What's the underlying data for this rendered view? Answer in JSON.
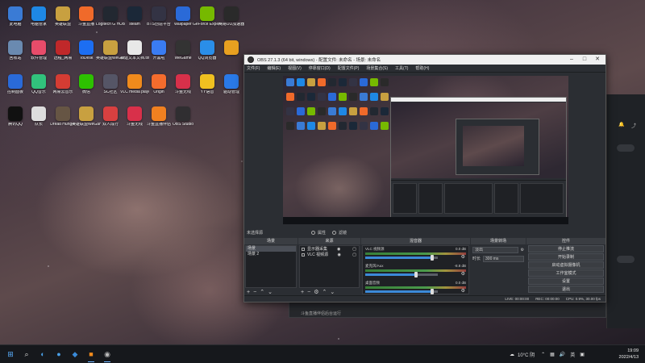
{
  "desktop": {
    "icons": [
      {
        "label": "此电脑",
        "icon": "computer-icon",
        "color": "#3a7bd5"
      },
      {
        "label": "电脑管家",
        "icon": "shield-icon",
        "color": "#1e88e5"
      },
      {
        "label": "英雄联盟",
        "icon": "game-icon",
        "color": "#c8a040"
      },
      {
        "label": "斗鱼直播",
        "icon": "fish-icon",
        "color": "#f06a2a"
      },
      {
        "label": "Logitech G HUB",
        "icon": "g-hub-icon",
        "color": "#222831"
      },
      {
        "label": "steam",
        "icon": "steam-icon",
        "color": "#1b2838"
      },
      {
        "label": "BTS创造平台",
        "icon": "grid-icon",
        "color": "#334"
      },
      {
        "label": "wallpaper",
        "icon": "wallpaper-icon",
        "color": "#2a6ad8"
      },
      {
        "label": "GeForce Experience",
        "icon": "nvidia-icon",
        "color": "#76b900"
      },
      {
        "label": "网易UU加速器",
        "icon": "uu-icon",
        "color": "#2a2a2a"
      },
      {
        "label": "回收站",
        "icon": "recycle-bin-icon",
        "color": "#6a8ab0"
      },
      {
        "label": "软件管理",
        "icon": "apps-icon",
        "color": "#e84c6a"
      },
      {
        "label": "远程_网易",
        "icon": "remote-icon",
        "color": "#c0282a"
      },
      {
        "label": "ToDesk",
        "icon": "todesk-icon",
        "color": "#1c6ef2"
      },
      {
        "label": "英雄联盟WeGame版",
        "icon": "game-icon",
        "color": "#c8a040"
      },
      {
        "label": "新建文本文档.txt",
        "icon": "text-file-icon",
        "color": "#e8e8e8"
      },
      {
        "label": "开黑啦",
        "icon": "chat-icon",
        "color": "#3a7cf2"
      },
      {
        "label": "WeGame",
        "icon": "wegame-icon",
        "color": "#333"
      },
      {
        "label": "QQ浏览器",
        "icon": "browser-icon",
        "color": "#2a8ee8"
      },
      {
        "label": "",
        "icon": "app-icon",
        "color": "#e8a020"
      },
      {
        "label": "控制面板",
        "icon": "control-panel-icon",
        "color": "#2a6ad8"
      },
      {
        "label": "QQ音乐",
        "icon": "music-icon",
        "color": "#31c27c"
      },
      {
        "label": "网易云音乐",
        "icon": "netease-music-icon",
        "color": "#d43c33"
      },
      {
        "label": "微信",
        "icon": "wechat-icon",
        "color": "#2dc100"
      },
      {
        "label": "SC社区",
        "icon": "community-icon",
        "color": "#556"
      },
      {
        "label": "VLC media player",
        "icon": "vlc-icon",
        "color": "#f08a1c"
      },
      {
        "label": "Origin",
        "icon": "origin-icon",
        "color": "#f56c2d"
      },
      {
        "label": "斗鱼无线",
        "icon": "fish-icon",
        "color": "#d8304a"
      },
      {
        "label": "YY语音",
        "icon": "yy-icon",
        "color": "#f0c020"
      },
      {
        "label": "驱动管理",
        "icon": "driver-icon",
        "color": "#2a7ae8"
      },
      {
        "label": "腾讯QQ",
        "icon": "qq-icon",
        "color": "#111"
      },
      {
        "label": "队长",
        "icon": "file-icon",
        "color": "#ddd"
      },
      {
        "label": "Dread Hunger",
        "icon": "game-icon",
        "color": "#665544"
      },
      {
        "label": "英雄联盟WeGame版",
        "icon": "game-icon",
        "color": "#c8a040"
      },
      {
        "label": "双人成行",
        "icon": "game-icon",
        "color": "#d84040"
      },
      {
        "label": "斗鱼无线",
        "icon": "fish-icon",
        "color": "#d8304a"
      },
      {
        "label": "斗鱼直播伴侣",
        "icon": "fish-icon",
        "color": "#f08020"
      },
      {
        "label": "OBS Studio",
        "icon": "obs-icon",
        "color": "#302e31"
      }
    ]
  },
  "obs": {
    "title": "OBS 27.1.3 (64 bit, windows) - 配置文件: 未命名 - 场景: 未命名",
    "menu": [
      "文件(F)",
      "编辑(E)",
      "视图(V)",
      "停靠窗口(D)",
      "配置文件(P)",
      "场景集合(S)",
      "工具(T)",
      "帮助(H)"
    ],
    "scene_strip": {
      "label": "未选择源",
      "props": "属性",
      "filters": "滤镜"
    },
    "docks": {
      "scenes": {
        "title": "场景",
        "items": [
          "场景",
          "场景 2"
        ]
      },
      "sources": {
        "title": "来源",
        "items": [
          "显示器采集",
          "VLC 视频源"
        ]
      },
      "mixer": {
        "title": "混音器",
        "channels": [
          {
            "name": "VLC 视频源",
            "db": "0.0 dB",
            "fill": 0.92
          },
          {
            "name": "麦克风/Aux",
            "db": "-8.8 dB",
            "fill": 0.7
          },
          {
            "name": "桌面音频",
            "db": "0.0 dB",
            "fill": 0.92
          }
        ]
      },
      "transitions": {
        "title": "场景转场",
        "type": "淡出",
        "duration_label": "时长",
        "duration": "300 ms"
      },
      "controls": {
        "title": "控件",
        "buttons": [
          "停止推流",
          "开始录制",
          "启动虚拟摄像机",
          "工作室模式",
          "设置",
          "退出"
        ]
      }
    },
    "status": {
      "live": "LIVE: 00:00:00",
      "rec": "REC: 00:00:00",
      "cpu": "CPU: 0.9%, 30.00 fps"
    }
  },
  "behind": {
    "hint": "斗鱼直播伴侣后台运行",
    "extra_btn": "退出"
  },
  "taskbar": {
    "weather": "10°C 阴",
    "lang": "英",
    "time": "19:09",
    "date": "2022/4/13"
  }
}
